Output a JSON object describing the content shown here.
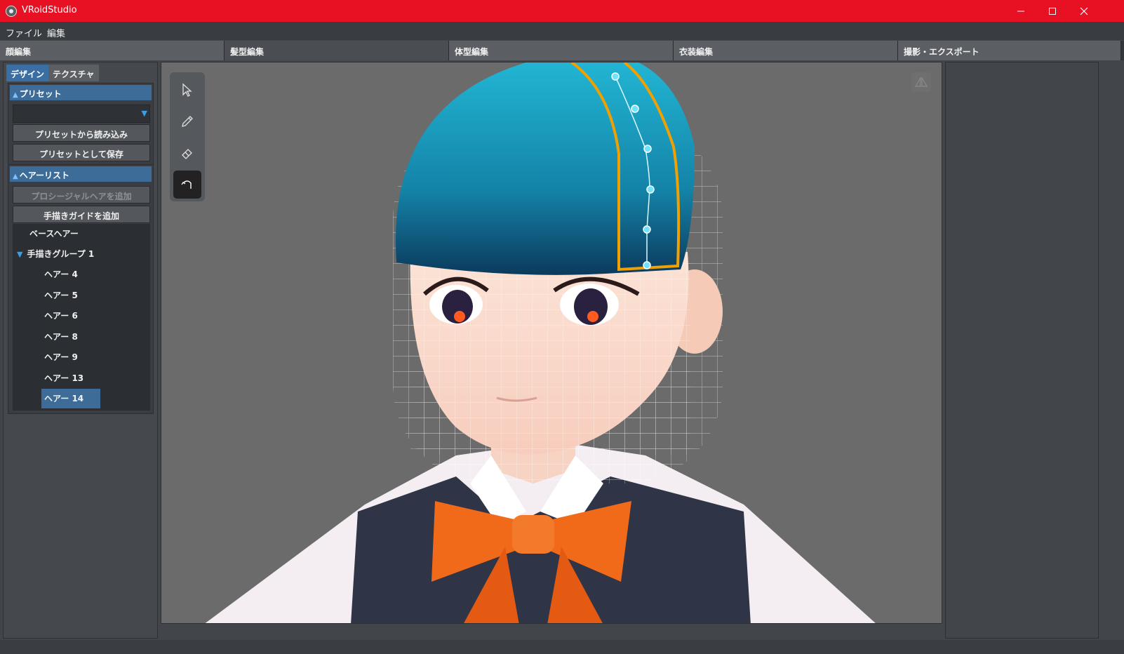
{
  "window": {
    "title": "VRoidStudio",
    "controls": [
      "minimize",
      "maximize",
      "close"
    ]
  },
  "menu": {
    "items": [
      "ファイル",
      "編集"
    ]
  },
  "main_tabs": [
    {
      "label": "顔編集"
    },
    {
      "label": "髪型編集"
    },
    {
      "label": "体型編集"
    },
    {
      "label": "衣装編集"
    },
    {
      "label": "撮影・エクスポート"
    }
  ],
  "left_panel": {
    "subtabs": [
      "デザイン",
      "テクスチャ"
    ],
    "preset": {
      "header": "プリセット",
      "select_value": "",
      "load_button": "プリセットから読み込み",
      "save_button": "プリセットとして保存"
    },
    "hair_list": {
      "header": "ヘアーリスト",
      "add_procedural_button": "プロシージャルヘアを追加",
      "add_guide_button": "手描きガイドを追加",
      "base_item": "ベースヘアー",
      "group": "手描きグループ 1",
      "items": [
        "ヘアー 4",
        "ヘアー 5",
        "ヘアー 6",
        "ヘアー 8",
        "ヘアー 9",
        "ヘアー 13",
        "ヘアー 14"
      ],
      "selected": "ヘアー 14"
    }
  },
  "viewport": {
    "tools": [
      "select-tool",
      "pen-tool",
      "eraser-tool",
      "smooth-curve-tool"
    ],
    "active_tool": "smooth-curve-tool",
    "colors": {
      "background": "#6b6b6b",
      "hair": "#1a8fb0",
      "guide_outline": "#f0a000",
      "control_point": "#6fe3ff",
      "bow": "#f06a1a"
    }
  },
  "colors": {
    "titlebar": "#e81123",
    "accent": "#3d6c99",
    "panel": "#45494e"
  }
}
